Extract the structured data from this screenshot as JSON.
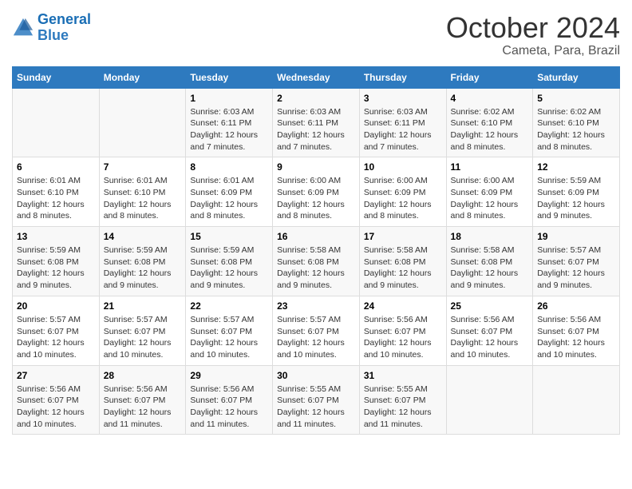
{
  "header": {
    "logo_line1": "General",
    "logo_line2": "Blue",
    "month": "October 2024",
    "location": "Cameta, Para, Brazil"
  },
  "weekdays": [
    "Sunday",
    "Monday",
    "Tuesday",
    "Wednesday",
    "Thursday",
    "Friday",
    "Saturday"
  ],
  "weeks": [
    [
      {
        "day": "",
        "info": ""
      },
      {
        "day": "",
        "info": ""
      },
      {
        "day": "1",
        "info": "Sunrise: 6:03 AM\nSunset: 6:11 PM\nDaylight: 12 hours and 7 minutes."
      },
      {
        "day": "2",
        "info": "Sunrise: 6:03 AM\nSunset: 6:11 PM\nDaylight: 12 hours and 7 minutes."
      },
      {
        "day": "3",
        "info": "Sunrise: 6:03 AM\nSunset: 6:11 PM\nDaylight: 12 hours and 7 minutes."
      },
      {
        "day": "4",
        "info": "Sunrise: 6:02 AM\nSunset: 6:10 PM\nDaylight: 12 hours and 8 minutes."
      },
      {
        "day": "5",
        "info": "Sunrise: 6:02 AM\nSunset: 6:10 PM\nDaylight: 12 hours and 8 minutes."
      }
    ],
    [
      {
        "day": "6",
        "info": "Sunrise: 6:01 AM\nSunset: 6:10 PM\nDaylight: 12 hours and 8 minutes."
      },
      {
        "day": "7",
        "info": "Sunrise: 6:01 AM\nSunset: 6:10 PM\nDaylight: 12 hours and 8 minutes."
      },
      {
        "day": "8",
        "info": "Sunrise: 6:01 AM\nSunset: 6:09 PM\nDaylight: 12 hours and 8 minutes."
      },
      {
        "day": "9",
        "info": "Sunrise: 6:00 AM\nSunset: 6:09 PM\nDaylight: 12 hours and 8 minutes."
      },
      {
        "day": "10",
        "info": "Sunrise: 6:00 AM\nSunset: 6:09 PM\nDaylight: 12 hours and 8 minutes."
      },
      {
        "day": "11",
        "info": "Sunrise: 6:00 AM\nSunset: 6:09 PM\nDaylight: 12 hours and 8 minutes."
      },
      {
        "day": "12",
        "info": "Sunrise: 5:59 AM\nSunset: 6:09 PM\nDaylight: 12 hours and 9 minutes."
      }
    ],
    [
      {
        "day": "13",
        "info": "Sunrise: 5:59 AM\nSunset: 6:08 PM\nDaylight: 12 hours and 9 minutes."
      },
      {
        "day": "14",
        "info": "Sunrise: 5:59 AM\nSunset: 6:08 PM\nDaylight: 12 hours and 9 minutes."
      },
      {
        "day": "15",
        "info": "Sunrise: 5:59 AM\nSunset: 6:08 PM\nDaylight: 12 hours and 9 minutes."
      },
      {
        "day": "16",
        "info": "Sunrise: 5:58 AM\nSunset: 6:08 PM\nDaylight: 12 hours and 9 minutes."
      },
      {
        "day": "17",
        "info": "Sunrise: 5:58 AM\nSunset: 6:08 PM\nDaylight: 12 hours and 9 minutes."
      },
      {
        "day": "18",
        "info": "Sunrise: 5:58 AM\nSunset: 6:08 PM\nDaylight: 12 hours and 9 minutes."
      },
      {
        "day": "19",
        "info": "Sunrise: 5:57 AM\nSunset: 6:07 PM\nDaylight: 12 hours and 9 minutes."
      }
    ],
    [
      {
        "day": "20",
        "info": "Sunrise: 5:57 AM\nSunset: 6:07 PM\nDaylight: 12 hours and 10 minutes."
      },
      {
        "day": "21",
        "info": "Sunrise: 5:57 AM\nSunset: 6:07 PM\nDaylight: 12 hours and 10 minutes."
      },
      {
        "day": "22",
        "info": "Sunrise: 5:57 AM\nSunset: 6:07 PM\nDaylight: 12 hours and 10 minutes."
      },
      {
        "day": "23",
        "info": "Sunrise: 5:57 AM\nSunset: 6:07 PM\nDaylight: 12 hours and 10 minutes."
      },
      {
        "day": "24",
        "info": "Sunrise: 5:56 AM\nSunset: 6:07 PM\nDaylight: 12 hours and 10 minutes."
      },
      {
        "day": "25",
        "info": "Sunrise: 5:56 AM\nSunset: 6:07 PM\nDaylight: 12 hours and 10 minutes."
      },
      {
        "day": "26",
        "info": "Sunrise: 5:56 AM\nSunset: 6:07 PM\nDaylight: 12 hours and 10 minutes."
      }
    ],
    [
      {
        "day": "27",
        "info": "Sunrise: 5:56 AM\nSunset: 6:07 PM\nDaylight: 12 hours and 10 minutes."
      },
      {
        "day": "28",
        "info": "Sunrise: 5:56 AM\nSunset: 6:07 PM\nDaylight: 12 hours and 11 minutes."
      },
      {
        "day": "29",
        "info": "Sunrise: 5:56 AM\nSunset: 6:07 PM\nDaylight: 12 hours and 11 minutes."
      },
      {
        "day": "30",
        "info": "Sunrise: 5:55 AM\nSunset: 6:07 PM\nDaylight: 12 hours and 11 minutes."
      },
      {
        "day": "31",
        "info": "Sunrise: 5:55 AM\nSunset: 6:07 PM\nDaylight: 12 hours and 11 minutes."
      },
      {
        "day": "",
        "info": ""
      },
      {
        "day": "",
        "info": ""
      }
    ]
  ]
}
